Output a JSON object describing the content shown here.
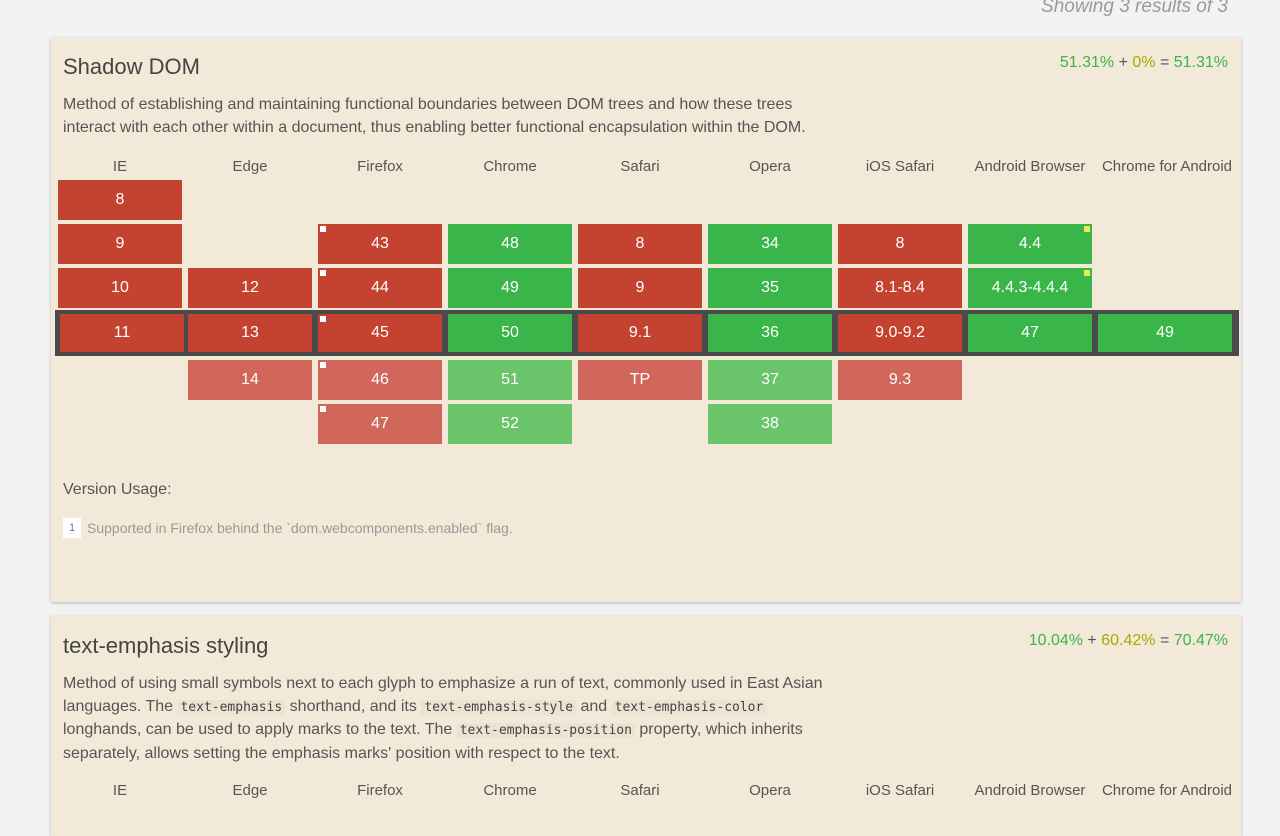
{
  "results_text": "Showing 3 results of 3",
  "browsers": [
    "IE",
    "Edge",
    "Firefox",
    "Chrome",
    "Safari",
    "Opera",
    "iOS Safari",
    "Android Browser",
    "Chrome for Android"
  ],
  "features": [
    {
      "title": "Shadow DOM",
      "usage": {
        "supported": "51.31%",
        "plus": "+",
        "partial": "0%",
        "equals": "=",
        "total": "51.31%"
      },
      "description": "Method of establishing and maintaining functional boundaries between DOM trees and how these trees interact with each other within a document, thus enabling better functional encapsulation within the DOM.",
      "version_usage_label": "Version Usage:",
      "footnote": {
        "number": "1",
        "text": "Supported in Firefox behind the `dom.webcomponents.enabled` flag."
      },
      "cells": {
        "ie_8": "8",
        "ie_9": "9",
        "ie_10": "10",
        "ie_11": "11",
        "edge_12": "12",
        "edge_13": "13",
        "edge_14": "14",
        "ff_43": "43",
        "ff_44": "44",
        "ff_45": "45",
        "ff_46": "46",
        "ff_47": "47",
        "ch_48": "48",
        "ch_49": "49",
        "ch_50": "50",
        "ch_51": "51",
        "ch_52": "52",
        "sa_8": "8",
        "sa_9": "9",
        "sa_91": "9.1",
        "sa_tp": "TP",
        "op_34": "34",
        "op_35": "35",
        "op_36": "36",
        "op_37": "37",
        "op_38": "38",
        "ios_8": "8",
        "ios_81": "8.1-8.4",
        "ios_90": "9.0-9.2",
        "ios_93": "9.3",
        "an_44": "4.4",
        "an_443": "4.4.3-4.4.4",
        "an_47": "47",
        "cfa_49": "49"
      }
    },
    {
      "title": "text-emphasis styling",
      "usage": {
        "supported": "10.04%",
        "plus": "+",
        "partial": "60.42%",
        "equals": "=",
        "total": "70.47%"
      },
      "description": {
        "p1": "Method of using small symbols next to each glyph to emphasize a run of text, commonly used in East Asian languages. The ",
        "c1": "text-emphasis",
        "p2": " shorthand, and its ",
        "c2": "text-emphasis-style",
        "p3": " and ",
        "c3": "text-emphasis-color",
        "p4": " longhands, can be used to apply marks to the text. The ",
        "c4": "text-emphasis-position",
        "p5": " property, which inherits separately, allows setting the emphasis marks' position with respect to the text."
      }
    }
  ]
}
